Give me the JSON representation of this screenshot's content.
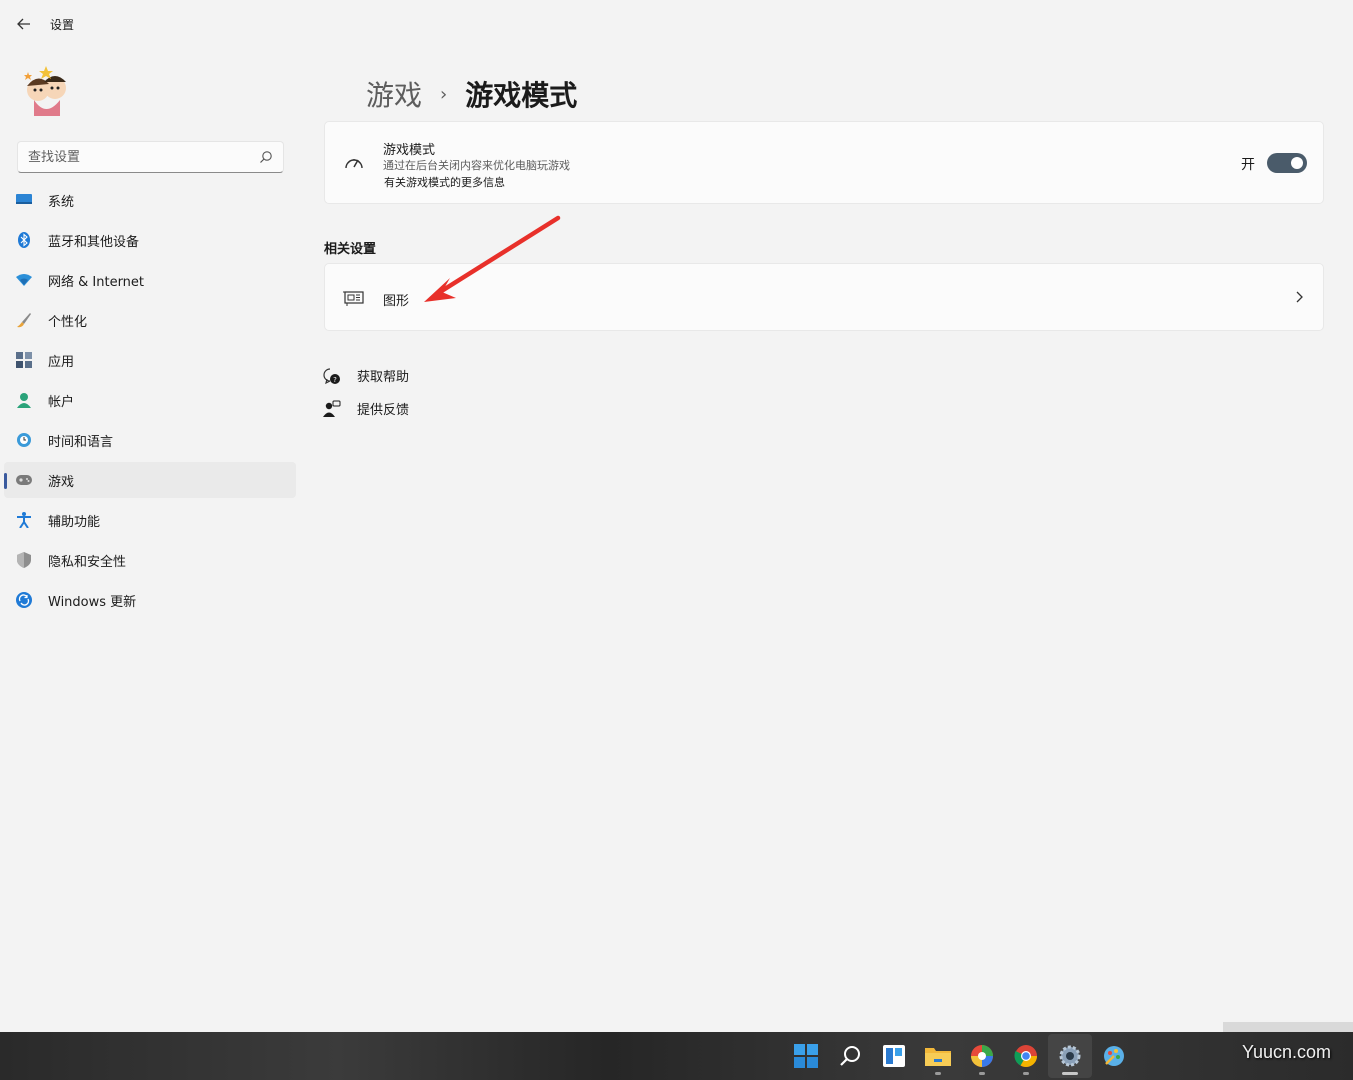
{
  "window": {
    "title": "设置"
  },
  "search": {
    "placeholder": "查找设置"
  },
  "nav": {
    "items": [
      {
        "label": "系统",
        "icon": "monitor-icon"
      },
      {
        "label": "蓝牙和其他设备",
        "icon": "bluetooth-icon"
      },
      {
        "label": "网络 & Internet",
        "icon": "wifi-icon"
      },
      {
        "label": "个性化",
        "icon": "brush-icon"
      },
      {
        "label": "应用",
        "icon": "apps-icon"
      },
      {
        "label": "帐户",
        "icon": "account-icon"
      },
      {
        "label": "时间和语言",
        "icon": "globe-clock-icon"
      },
      {
        "label": "游戏",
        "icon": "gamepad-icon",
        "active": true
      },
      {
        "label": "辅助功能",
        "icon": "accessibility-icon"
      },
      {
        "label": "隐私和安全性",
        "icon": "shield-icon"
      },
      {
        "label": "Windows 更新",
        "icon": "update-icon"
      }
    ]
  },
  "breadcrumb": {
    "parent": "游戏",
    "separator": "›",
    "current": "游戏模式"
  },
  "game_mode": {
    "title": "游戏模式",
    "description": "通过在后台关闭内容来优化电脑玩游戏",
    "link": "有关游戏模式的更多信息",
    "toggle_label": "开",
    "toggle_on": true
  },
  "related": {
    "section_title": "相关设置",
    "graphics_label": "图形"
  },
  "help": {
    "get_help": "获取帮助",
    "feedback": "提供反馈"
  },
  "taskbar": {
    "icons": [
      "windows-start-icon",
      "search-icon",
      "widgets-icon",
      "file-explorer-icon",
      "colorful-browser-icon",
      "chrome-icon",
      "settings-gear-icon",
      "paint-icon"
    ],
    "watermark": "Yuucn.com"
  },
  "colors": {
    "accent": "#3a5a9e",
    "toggle": "#4a5b6a",
    "annotation_arrow": "#e8302a"
  }
}
